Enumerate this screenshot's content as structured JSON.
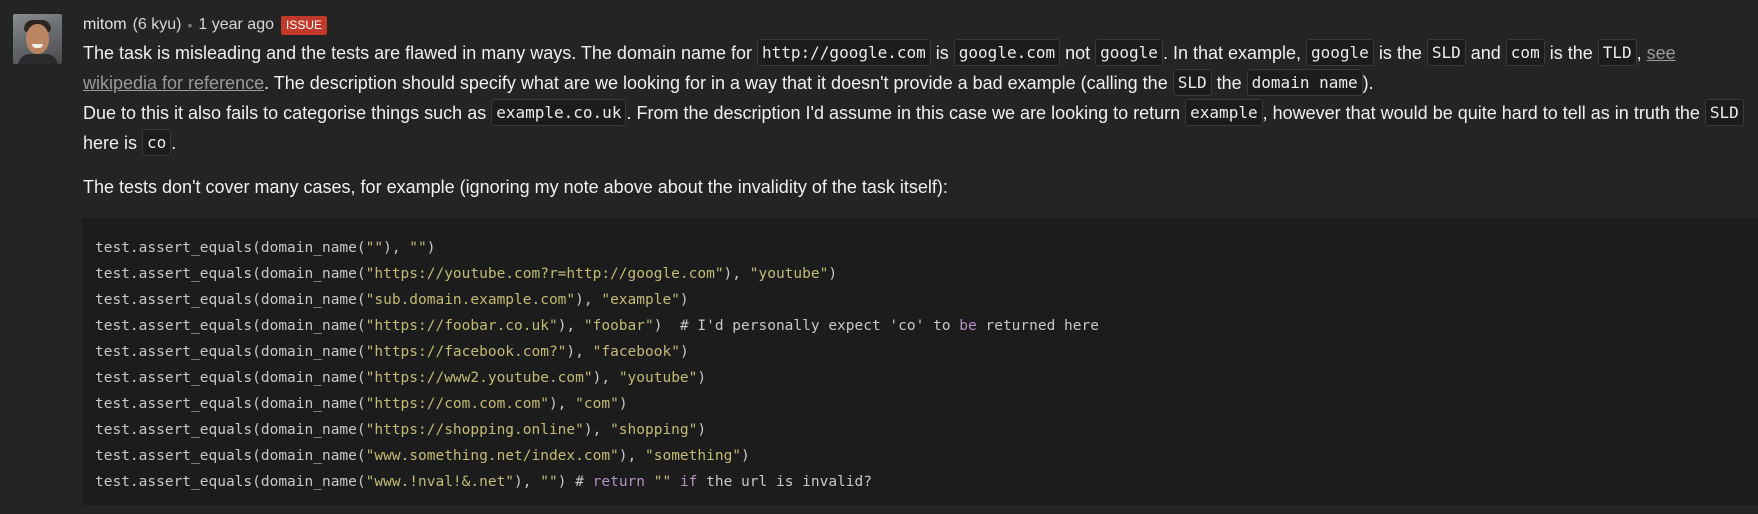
{
  "author": {
    "username": "mitom",
    "rank": "(6 kyu)",
    "timestamp": "1 year ago",
    "badge": "ISSUE"
  },
  "comment": {
    "p1": {
      "t1": "The task is misleading and the tests are flawed in many ways. The domain name for ",
      "c1": "http://google.com",
      "t2": " is ",
      "c2": "google.com",
      "t3": " not ",
      "c3": "google",
      "t4": ". In that example, ",
      "c4": "google",
      "t5": " is the ",
      "c5": "SLD",
      "t6": " and ",
      "c6": "com",
      "t7": " is the ",
      "c7": "TLD",
      "t8": ", ",
      "link": "see wikipedia for reference",
      "t9": ". The description should specify what are we looking for in a way that it doesn't provide a bad example (calling the ",
      "c8": "SLD",
      "t10": " the ",
      "c9": "domain name",
      "t11": ")."
    },
    "p1b": {
      "t1": "Due to this it also fails to categorise things such as ",
      "c1": "example.co.uk",
      "t2": ". From the description I'd assume in this case we are looking to return ",
      "c2": "example",
      "t3": ", however that would be quite hard to tell as in truth the ",
      "c3": "SLD",
      "t4": " here is ",
      "c4": "co",
      "t5": "."
    },
    "p2": "The tests don't cover many cases, for example (ignoring my note above about the invalidity of the task itself):"
  },
  "code": {
    "l1": {
      "a": "test.assert_equals(domain_name(",
      "s1": "\"\"",
      "b": "), ",
      "s2": "\"\"",
      "c": ")"
    },
    "l2": {
      "a": "test.assert_equals(domain_name(",
      "s1": "\"https://youtube.com?r=http://google.com\"",
      "b": "), ",
      "s2": "\"youtube\"",
      "c": ")"
    },
    "l3": {
      "a": "test.assert_equals(domain_name(",
      "s1": "\"sub.domain.example.com\"",
      "b": "), ",
      "s2": "\"example\"",
      "c": ")"
    },
    "l4": {
      "a": "test.assert_equals(domain_name(",
      "s1": "\"https://foobar.co.uk\"",
      "b": "), ",
      "s2": "\"foobar\"",
      "c": ")  # I'd personally expect 'co' to ",
      "k1": "be",
      "d": " returned here"
    },
    "l5": {
      "a": "test.assert_equals(domain_name(",
      "s1": "\"https://facebook.com?\"",
      "b": "), ",
      "s2": "\"facebook\"",
      "c": ")"
    },
    "l6": {
      "a": "test.assert_equals(domain_name(",
      "s1": "\"https://www2.youtube.com\"",
      "b": "), ",
      "s2": "\"youtube\"",
      "c": ")"
    },
    "l7": {
      "a": "test.assert_equals(domain_name(",
      "s1": "\"https://com.com.com\"",
      "b": "), ",
      "s2": "\"com\"",
      "c": ")"
    },
    "l8": {
      "a": "test.assert_equals(domain_name(",
      "s1": "\"https://shopping.online\"",
      "b": "), ",
      "s2": "\"shopping\"",
      "c": ")"
    },
    "l9": {
      "a": "test.assert_equals(domain_name(",
      "s1": "\"www.something.net/index.com\"",
      "b": "), ",
      "s2": "\"something\"",
      "c": ")"
    },
    "l10": {
      "a": "test.assert_equals(domain_name(",
      "s1": "\"www.!nval!&.net\"",
      "b": "), ",
      "s2": "\"\"",
      "c": ") # ",
      "k1": "return",
      "s3": " \"\" ",
      "k2": "if",
      "d": " the url is invalid?"
    }
  },
  "colors": {
    "background": "#242424",
    "code_bg": "#1c1c1c",
    "badge": "#c0392b",
    "string": "#c3bb75",
    "keyword": "#b591c9"
  }
}
